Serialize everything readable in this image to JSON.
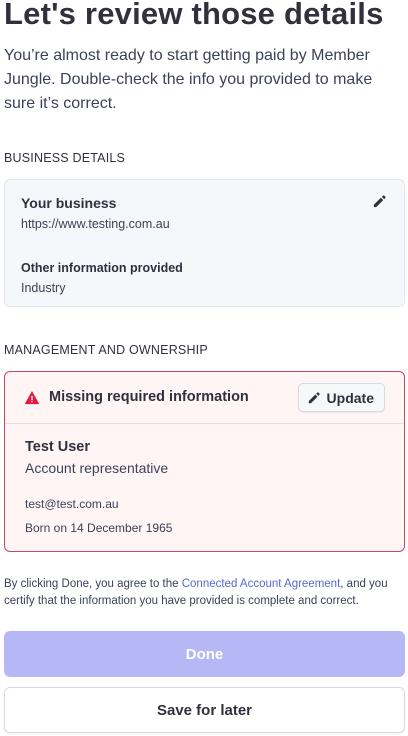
{
  "header": {
    "title": "Let's review those details",
    "intro": "You’re almost ready to start getting paid by Member Jungle. Double-check the info you provided to make sure it’s correct."
  },
  "business_section": {
    "heading": "BUSINESS DETAILS",
    "name_label": "Your business",
    "url": "https://www.testing.com.au",
    "other_label": "Other information provided",
    "other_value": "Industry",
    "edit_icon": "pencil-icon"
  },
  "management_section": {
    "heading": "MANAGEMENT AND OWNERSHIP",
    "warning": "Missing required information",
    "warning_icon": "alert-triangle-icon",
    "update_label": "Update",
    "person": {
      "name": "Test User",
      "role": "Account representative",
      "email": "test@test.com.au",
      "born": "Born on 14 December 1965"
    }
  },
  "agreement": {
    "prefix": "By clicking Done, you agree to the ",
    "link": "Connected Account Agreement",
    "suffix": ", and you certify that the information you have provided is complete and correct."
  },
  "actions": {
    "done_label": "Done",
    "save_later_label": "Save for later"
  },
  "colors": {
    "accent": "#5469d4",
    "done_disabled": "#b5b8f5",
    "error_border": "#c4466b",
    "warning_icon": "#df1b41"
  }
}
